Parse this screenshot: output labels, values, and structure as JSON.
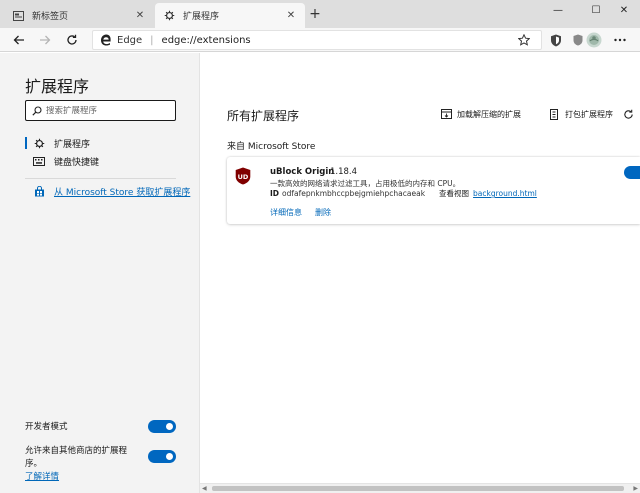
{
  "tabs": [
    {
      "label": "新标签页",
      "icon": "page-icon"
    },
    {
      "label": "扩展程序",
      "icon": "puzzle-gear-icon"
    }
  ],
  "address": {
    "site_name": "Edge",
    "separator": "|",
    "url": "edge://extensions"
  },
  "sidebar": {
    "title": "扩展程序",
    "search_placeholder": "搜索扩展程序",
    "items": [
      {
        "label": "扩展程序",
        "icon": "extensions-gear-icon",
        "active": true
      },
      {
        "label": "键盘快捷键",
        "icon": "keyboard-icon",
        "active": false
      }
    ],
    "store_link": "从 Microsoft Store 获取扩展程序",
    "developer_mode_label": "开发者模式",
    "developer_mode_on": true,
    "allow_other_stores_label": "允许来自其他商店的扩展程序。",
    "allow_other_stores_learn": "了解详情",
    "allow_other_stores_on": true
  },
  "main": {
    "title": "所有扩展程序",
    "actions": [
      {
        "label": "加载解压缩的扩展",
        "icon": "load-unpacked-icon"
      },
      {
        "label": "打包扩展程序",
        "icon": "pack-extension-icon"
      },
      {
        "label": "",
        "icon": "refresh-icon"
      }
    ],
    "section_label": "来自 Microsoft Store",
    "extension": {
      "name": "uBlock Origin",
      "version": "1.18.4",
      "description": "一款高效的网络请求过滤工具，占用极低的内存和 CPU。",
      "id_label": "ID",
      "id": "odfafepnkmbhccpbejgmiehpchacaeak",
      "inspect_label": "查看视图",
      "inspect_link": "background.html",
      "details_label": "详细信息",
      "remove_label": "删除",
      "enabled": true,
      "logo_text": "UD",
      "logo_color": "#800000"
    }
  },
  "colors": {
    "accent": "#0067c0",
    "link": "#0067b8",
    "sidebar_bg": "#f3f3f3"
  }
}
